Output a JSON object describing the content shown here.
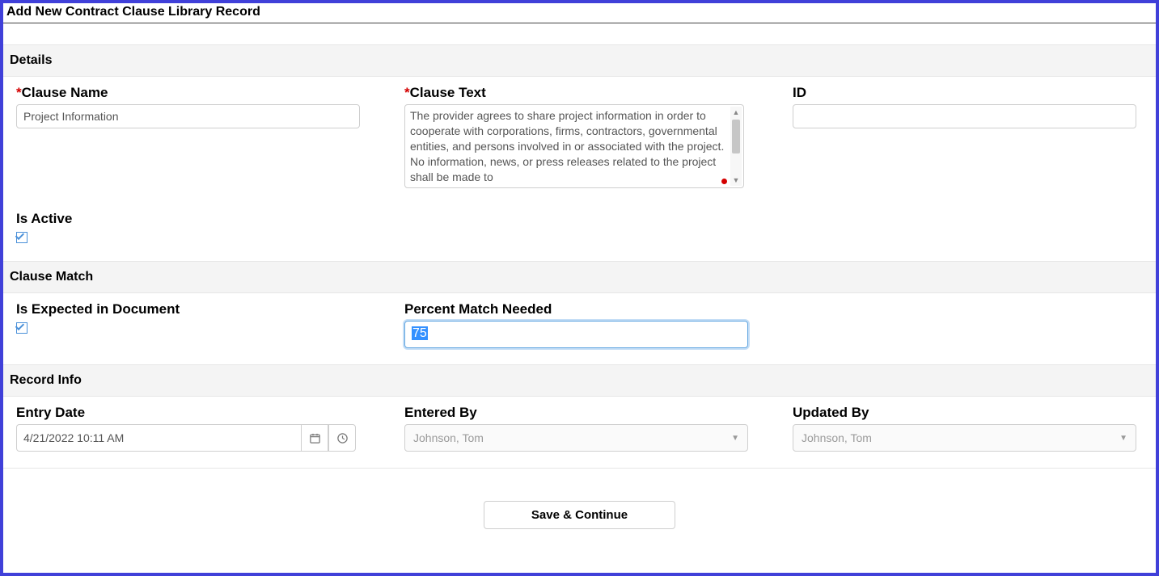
{
  "title": "Add New Contract Clause Library Record",
  "sections": {
    "details": {
      "header": "Details",
      "clause_name": {
        "label": "Clause Name",
        "required": true,
        "value": "Project Information"
      },
      "clause_text": {
        "label": "Clause Text",
        "required": true,
        "value": "The provider agrees to share project information in order to cooperate with corporations, firms, contractors, governmental entities, and persons involved in or associated with the project. No information, news, or press releases related to the project shall be made to"
      },
      "id": {
        "label": "ID",
        "value": ""
      },
      "is_active": {
        "label": "Is Active",
        "checked": true
      }
    },
    "clause_match": {
      "header": "Clause Match",
      "is_expected": {
        "label": "Is Expected in Document",
        "checked": true
      },
      "percent_match": {
        "label": "Percent Match Needed",
        "value": "75"
      }
    },
    "record_info": {
      "header": "Record Info",
      "entry_date": {
        "label": "Entry Date",
        "value": "4/21/2022 10:11 AM"
      },
      "entered_by": {
        "label": "Entered By",
        "value": "Johnson, Tom"
      },
      "updated_by": {
        "label": "Updated By",
        "value": "Johnson, Tom"
      }
    }
  },
  "footer": {
    "save_label": "Save & Continue"
  }
}
